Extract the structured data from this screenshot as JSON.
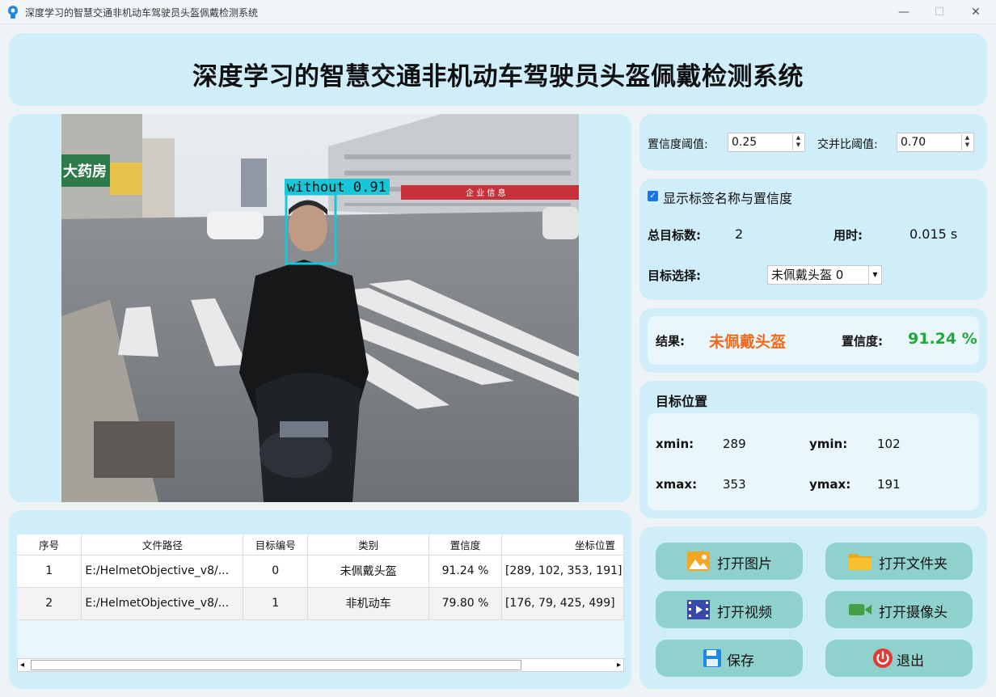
{
  "window": {
    "title": "深度学习的智慧交通非机动车驾驶员头盔佩戴检测系统",
    "min": "—",
    "max": "☐",
    "close": "✕"
  },
  "header": {
    "title": "深度学习的智慧交通非机动车驾驶员头盔佩戴检测系统"
  },
  "scene": {
    "detection_label": "without  0.91",
    "detection_color": "#17c6d8",
    "shop_sign": "大药房",
    "store_banner": "企 业 信 息"
  },
  "table": {
    "columns": [
      "序号",
      "文件路径",
      "目标编号",
      "类别",
      "置信度",
      "坐标位置"
    ],
    "rows": [
      [
        "1",
        "E:/HelmetObjective_v8/...",
        "0",
        "未佩戴头盔",
        "91.24 %",
        "[289, 102, 353, 191]"
      ],
      [
        "2",
        "E:/HelmetObjective_v8/...",
        "1",
        "非机动车",
        "79.80 %",
        "[176, 79, 425, 499]"
      ]
    ],
    "scroll_left": "◂",
    "scroll_right": "▸"
  },
  "thresholds": {
    "conf_label": "置信度阈值:",
    "conf_value": "0.25",
    "iou_label": "交并比阈值:",
    "iou_value": "0.70"
  },
  "stats": {
    "show_label": "显示标签名称与置信度",
    "show_checked": true,
    "total_label": "总目标数:",
    "total_value": "2",
    "time_label": "用时:",
    "time_value": "0.015 s",
    "select_label": "目标选择:",
    "select_value": "未佩戴头盔  0"
  },
  "result": {
    "result_label": "结果:",
    "result_value": "未佩戴头盔",
    "result_color": "#f26a1b",
    "conf_label": "置信度:",
    "conf_value": "91.24 %",
    "conf_color": "#22a83a"
  },
  "position": {
    "title": "目标位置",
    "xmin_label": "xmin:",
    "xmin": "289",
    "ymin_label": "ymin:",
    "ymin": "102",
    "xmax_label": "xmax:",
    "xmax": "353",
    "ymax_label": "ymax:",
    "ymax": "191"
  },
  "buttons": {
    "open_image": "打开图片",
    "open_folder": "打开文件夹",
    "open_video": "打开视频",
    "open_camera": "打开摄像头",
    "save": "保存",
    "exit": "退出"
  }
}
